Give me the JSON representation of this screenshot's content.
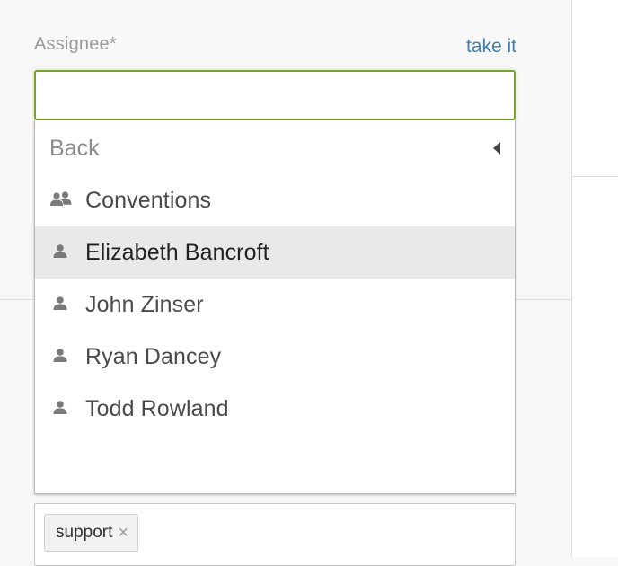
{
  "assignee": {
    "label": "Assignee*",
    "take_it": "take it",
    "input_value": ""
  },
  "dropdown": {
    "back_label": "Back",
    "items": [
      {
        "label": "Conventions",
        "icon": "group-icon",
        "selected": false
      },
      {
        "label": "Elizabeth Bancroft",
        "icon": "user-icon",
        "selected": true
      },
      {
        "label": "John Zinser",
        "icon": "user-icon",
        "selected": false
      },
      {
        "label": "Ryan Dancey",
        "icon": "user-icon",
        "selected": false
      },
      {
        "label": "Todd Rowland",
        "icon": "user-icon",
        "selected": false
      }
    ]
  },
  "tags": {
    "items": [
      {
        "label": "support",
        "remove": "×"
      }
    ]
  },
  "colors": {
    "focus_border": "#78a22f",
    "link": "#3f7fae",
    "selected_row": "#e9e9e9"
  }
}
